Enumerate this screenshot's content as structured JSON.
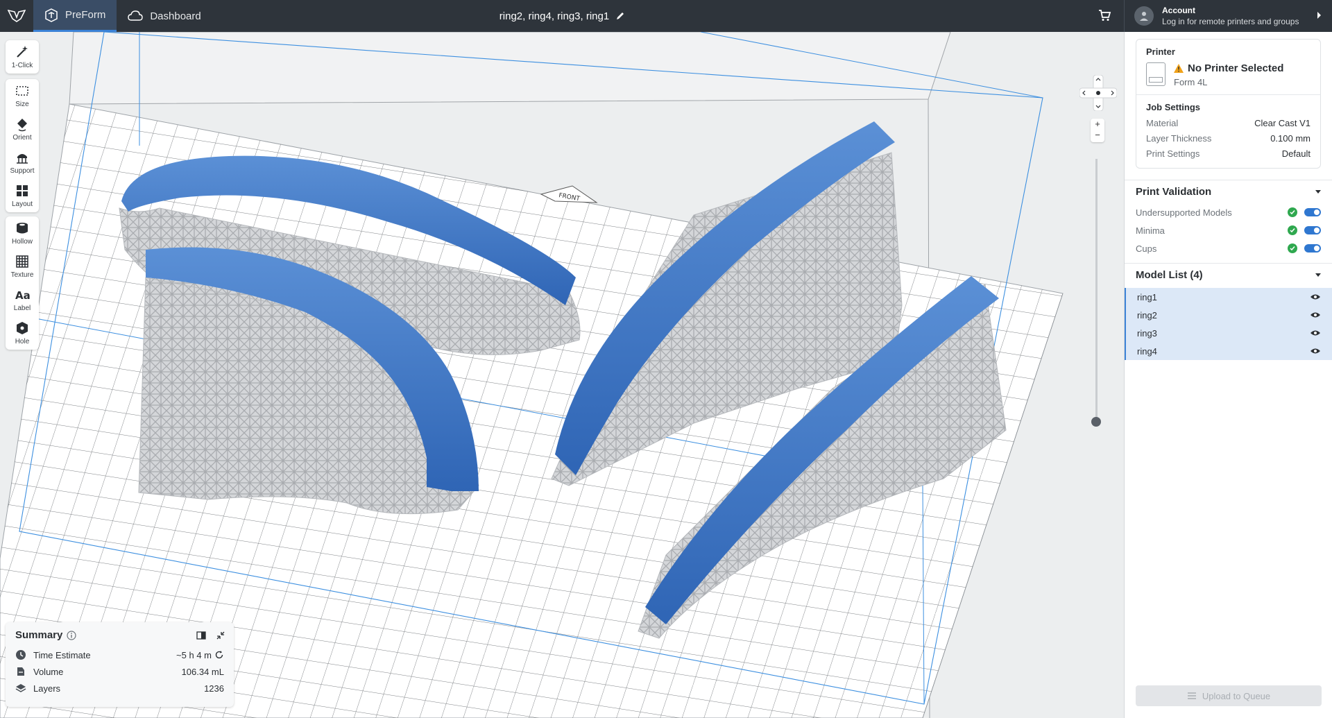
{
  "topbar": {
    "tabs": [
      {
        "label": "PreForm",
        "icon": "preform-icon",
        "active": true
      },
      {
        "label": "Dashboard",
        "icon": "cloud-icon",
        "active": false
      }
    ],
    "document_title": "ring2, ring4, ring3, ring1",
    "account": {
      "title": "Account",
      "subtitle": "Log in for remote printers and groups"
    }
  },
  "toolbar": {
    "groups": [
      [
        {
          "label": "1-Click",
          "icon": "magic-wand-icon"
        }
      ],
      [
        {
          "label": "Size",
          "icon": "size-icon"
        },
        {
          "label": "Orient",
          "icon": "orient-icon"
        },
        {
          "label": "Support",
          "icon": "support-icon"
        },
        {
          "label": "Layout",
          "icon": "layout-icon"
        }
      ],
      [
        {
          "label": "Hollow",
          "icon": "hollow-icon"
        },
        {
          "label": "Texture",
          "icon": "texture-icon"
        },
        {
          "label": "Label",
          "icon": "label-icon"
        },
        {
          "label": "Hole",
          "icon": "hole-icon"
        }
      ]
    ]
  },
  "scene": {
    "front_label": "FRONT"
  },
  "zoom": {
    "in": "+",
    "out": "−"
  },
  "summary": {
    "title": "Summary",
    "rows": [
      {
        "label": "Time Estimate",
        "value": "~5 h 4 m",
        "icon": "clock-icon"
      },
      {
        "label": "Volume",
        "value": "106.34 mL",
        "icon": "volume-icon"
      },
      {
        "label": "Layers",
        "value": "1236",
        "icon": "layers-icon"
      }
    ]
  },
  "panel": {
    "printer": {
      "heading": "Printer",
      "status": "No Printer Selected",
      "model": "Form 4L"
    },
    "job": {
      "heading": "Job Settings",
      "rows": [
        {
          "key": "Material",
          "value": "Clear Cast V1"
        },
        {
          "key": "Layer Thickness",
          "value": "0.100 mm"
        },
        {
          "key": "Print Settings",
          "value": "Default"
        }
      ]
    },
    "validation": {
      "heading": "Print Validation",
      "rows": [
        {
          "label": "Undersupported Models",
          "enabled": true
        },
        {
          "label": "Minima",
          "enabled": true
        },
        {
          "label": "Cups",
          "enabled": true
        }
      ]
    },
    "models": {
      "heading": "Model List (4)",
      "items": [
        "ring1",
        "ring2",
        "ring3",
        "ring4"
      ]
    },
    "upload_label": "Upload to Queue"
  },
  "colors": {
    "topbar": "#2e343b",
    "accent": "#3b82d6",
    "model_blue": "#3f78c9",
    "support_gray": "#c3c5c8"
  }
}
